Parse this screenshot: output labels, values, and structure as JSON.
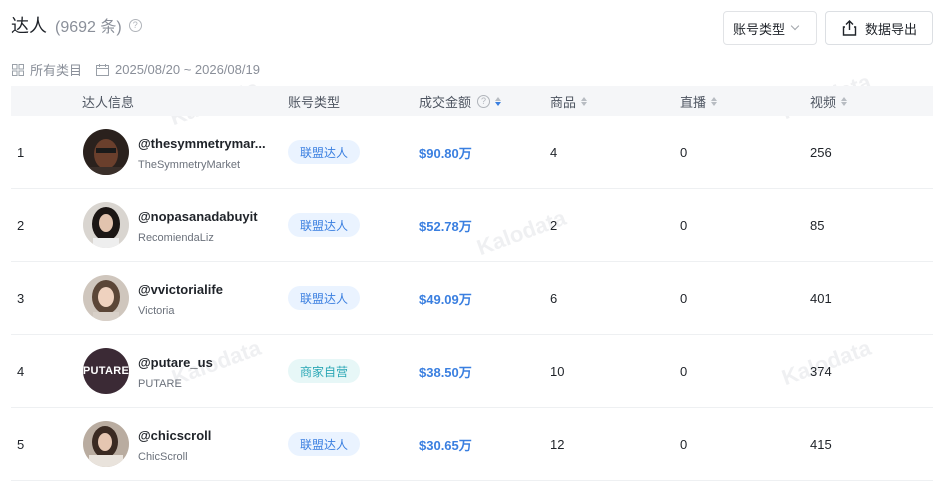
{
  "header": {
    "title": "达人",
    "count": "(9692 条)",
    "type_select_label": "账号类型",
    "export_label": "数据导出"
  },
  "filters": {
    "category": "所有类目",
    "date_range": "2025/08/20 ~ 2026/08/19"
  },
  "columns": {
    "info": "达人信息",
    "account_type": "账号类型",
    "amount": "成交金额",
    "products": "商品",
    "live": "直播",
    "video": "视频"
  },
  "rows": [
    {
      "rank": "1",
      "handle": "@thesymmetrymar...",
      "nickname": "TheSymmetryMarket",
      "type": "联盟达人",
      "type_kind": "affiliate",
      "amount": "$90.80万",
      "products": "4",
      "live": "0",
      "video": "256",
      "avatar": "man-dark"
    },
    {
      "rank": "2",
      "handle": "@nopasanadabuyit",
      "nickname": "RecomiendaLiz",
      "type": "联盟达人",
      "type_kind": "affiliate",
      "amount": "$52.78万",
      "products": "2",
      "live": "0",
      "video": "85",
      "avatar": "woman-dark-hair"
    },
    {
      "rank": "3",
      "handle": "@vvictorialife",
      "nickname": "Victoria",
      "type": "联盟达人",
      "type_kind": "affiliate",
      "amount": "$49.09万",
      "products": "6",
      "live": "0",
      "video": "401",
      "avatar": "woman-light"
    },
    {
      "rank": "4",
      "handle": "@putare_us",
      "nickname": "PUTARE",
      "type": "商家自营",
      "type_kind": "merchant",
      "amount": "$38.50万",
      "products": "10",
      "live": "0",
      "video": "374",
      "avatar": "putare-logo",
      "avatar_text": "PUTARE"
    },
    {
      "rank": "5",
      "handle": "@chicscroll",
      "nickname": "ChicScroll",
      "type": "联盟达人",
      "type_kind": "affiliate",
      "amount": "$30.65万",
      "products": "12",
      "live": "0",
      "video": "415",
      "avatar": "woman-brunette"
    }
  ],
  "watermark": "Kalodata",
  "colors": {
    "accent": "#3a7fe0",
    "affiliate_tag_bg": "#eaf3ff",
    "merchant_tag_text": "#2aa7b5",
    "merchant_tag_bg": "#e7f7f7"
  }
}
